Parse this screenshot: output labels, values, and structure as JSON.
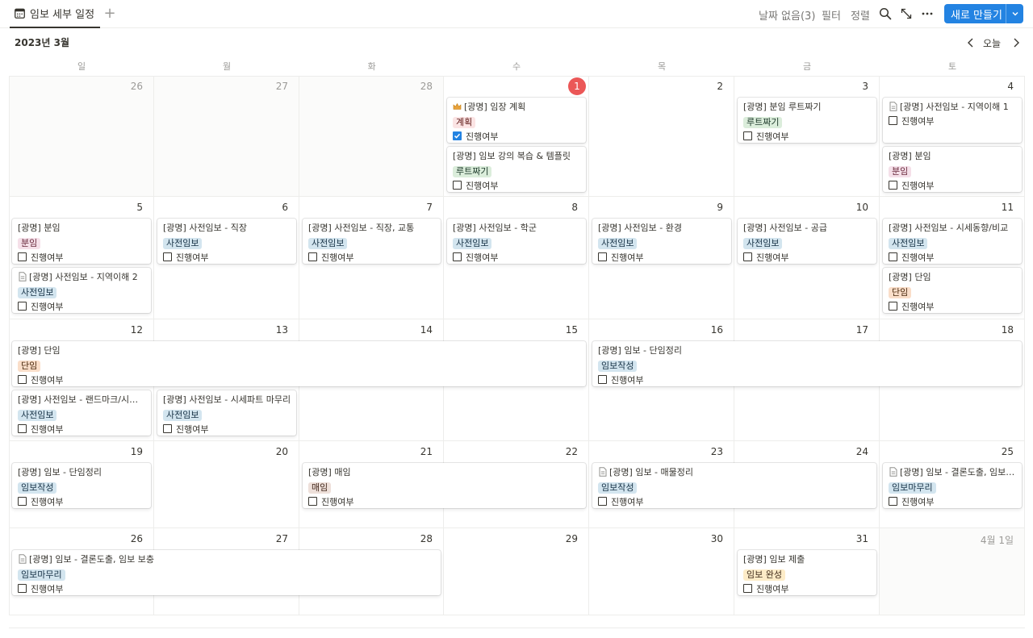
{
  "header": {
    "view_tab_label": "임보 세부 일정",
    "no_date": "날짜 없음(3)",
    "filter": "필터",
    "sort": "정렬",
    "new_button": "새로 만들기"
  },
  "calendar": {
    "month_title": "2023년 3월",
    "today_label": "오늘",
    "weekdays": [
      "일",
      "월",
      "화",
      "수",
      "목",
      "금",
      "토"
    ],
    "weeks": [
      [
        "26",
        "27",
        "28",
        "1",
        "2",
        "3",
        "4"
      ],
      [
        "5",
        "6",
        "7",
        "8",
        "9",
        "10",
        "11"
      ],
      [
        "12",
        "13",
        "14",
        "15",
        "16",
        "17",
        "18"
      ],
      [
        "19",
        "20",
        "21",
        "22",
        "23",
        "24",
        "25"
      ],
      [
        "26",
        "27",
        "28",
        "29",
        "30",
        "31",
        "4월 1일"
      ]
    ],
    "today_index": {
      "week": 0,
      "day": 3
    },
    "muted_days": [
      [
        0,
        0
      ],
      [
        0,
        1
      ],
      [
        0,
        2
      ],
      [
        4,
        6
      ]
    ]
  },
  "property_label": "진행여부",
  "tag_colors": {
    "계획": {
      "bg": "#fbe4e4",
      "fg": "#5d1715"
    },
    "루트짜기": {
      "bg": "#dbeddb",
      "fg": "#1c3829"
    },
    "분임": {
      "bg": "#f5e0e9",
      "fg": "#6a2a3d"
    },
    "사전임보": {
      "bg": "#d3e5ef",
      "fg": "#183347"
    },
    "단임": {
      "bg": "#fadec9",
      "fg": "#49290e"
    },
    "임보작성": {
      "bg": "#d3e5ef",
      "fg": "#183347"
    },
    "매임": {
      "bg": "#eee0da",
      "fg": "#442a1e"
    },
    "임보마무리": {
      "bg": "#d3e5ef",
      "fg": "#183347"
    },
    "임보 완성": {
      "bg": "#fdecc8",
      "fg": "#402c1b"
    }
  },
  "events": [
    {
      "title": "[광명] 임장 계획",
      "tag": "계획",
      "checked": true,
      "icon": "crown-icon",
      "week": 0,
      "start": 3,
      "span": 1,
      "slot": 0
    },
    {
      "title": "[광명] 임보 강의 복습 & 템플릿",
      "tag": "루트짜기",
      "checked": false,
      "icon": "",
      "week": 0,
      "start": 3,
      "span": 1,
      "slot": 1
    },
    {
      "title": "[광명] 분임 루트짜기",
      "tag": "루트짜기",
      "checked": false,
      "icon": "",
      "week": 0,
      "start": 5,
      "span": 1,
      "slot": 0
    },
    {
      "title": "[광명] 사전임보 - 지역이해 1",
      "tag": "",
      "checked": false,
      "icon": "page-icon",
      "week": 0,
      "start": 6,
      "span": 1,
      "slot": 0
    },
    {
      "title": "[광명] 분임",
      "tag": "분임",
      "checked": false,
      "icon": "",
      "week": 0,
      "start": 6,
      "span": 1,
      "slot": 1
    },
    {
      "title": "[광명] 분임",
      "tag": "분임",
      "checked": false,
      "icon": "",
      "week": 1,
      "start": 0,
      "span": 1,
      "slot": 0
    },
    {
      "title": "[광명] 사전임보 - 지역이해 2",
      "tag": "사전임보",
      "checked": false,
      "icon": "page-icon",
      "week": 1,
      "start": 0,
      "span": 1,
      "slot": 1
    },
    {
      "title": "[광명] 사전임보 - 직장",
      "tag": "사전임보",
      "checked": false,
      "icon": "",
      "week": 1,
      "start": 1,
      "span": 1,
      "slot": 0
    },
    {
      "title": "[광명] 사전임보 - 직장, 교통",
      "tag": "사전임보",
      "checked": false,
      "icon": "",
      "week": 1,
      "start": 2,
      "span": 1,
      "slot": 0
    },
    {
      "title": "[광명] 사전임보 - 학군",
      "tag": "사전임보",
      "checked": false,
      "icon": "",
      "week": 1,
      "start": 3,
      "span": 1,
      "slot": 0
    },
    {
      "title": "[광명] 사전임보 - 환경",
      "tag": "사전임보",
      "checked": false,
      "icon": "",
      "week": 1,
      "start": 4,
      "span": 1,
      "slot": 0
    },
    {
      "title": "[광명] 사전임보 - 공급",
      "tag": "사전임보",
      "checked": false,
      "icon": "",
      "week": 1,
      "start": 5,
      "span": 1,
      "slot": 0
    },
    {
      "title": "[광명] 사전임보 - 시세동향/비교",
      "tag": "사전임보",
      "checked": false,
      "icon": "",
      "week": 1,
      "start": 6,
      "span": 1,
      "slot": 0
    },
    {
      "title": "[광명] 단임",
      "tag": "단임",
      "checked": false,
      "icon": "",
      "week": 1,
      "start": 6,
      "span": 1,
      "slot": 1
    },
    {
      "title": "[광명] 단임",
      "tag": "단임",
      "checked": false,
      "icon": "",
      "week": 2,
      "start": 0,
      "span": 4,
      "slot": 0
    },
    {
      "title": "[광명] 임보 - 단임정리",
      "tag": "임보작성",
      "checked": false,
      "icon": "",
      "week": 2,
      "start": 4,
      "span": 3,
      "slot": 0
    },
    {
      "title": "[광명] 사전임보 - 랜드마크/시세파트",
      "tag": "사전임보",
      "checked": false,
      "icon": "",
      "week": 2,
      "start": 0,
      "span": 1,
      "slot": 1
    },
    {
      "title": "[광명] 사전임보 - 시세파트 마무리",
      "tag": "사전임보",
      "checked": false,
      "icon": "",
      "week": 2,
      "start": 1,
      "span": 1,
      "slot": 1
    },
    {
      "title": "[광명] 임보 - 단임정리",
      "tag": "임보작성",
      "checked": false,
      "icon": "",
      "week": 3,
      "start": 0,
      "span": 1,
      "slot": 0
    },
    {
      "title": "[광명] 매임",
      "tag": "매임",
      "checked": false,
      "icon": "",
      "week": 3,
      "start": 2,
      "span": 2,
      "slot": 0
    },
    {
      "title": "[광명] 임보 - 매물정리",
      "tag": "임보작성",
      "checked": false,
      "icon": "page-icon",
      "week": 3,
      "start": 4,
      "span": 2,
      "slot": 0
    },
    {
      "title": "[광명] 임보 - 결론도출, 임보 보충",
      "tag": "임보마무리",
      "checked": false,
      "icon": "page-icon",
      "week": 3,
      "start": 6,
      "span": 1,
      "slot": 0
    },
    {
      "title": "[광명] 임보 - 결론도출, 임보 보충",
      "tag": "임보마무리",
      "checked": false,
      "icon": "page-icon",
      "week": 4,
      "start": 0,
      "span": 3,
      "slot": 0
    },
    {
      "title": "[광명] 임보 제출",
      "tag": "임보 완성",
      "checked": false,
      "icon": "",
      "week": 4,
      "start": 5,
      "span": 1,
      "slot": 0
    }
  ]
}
